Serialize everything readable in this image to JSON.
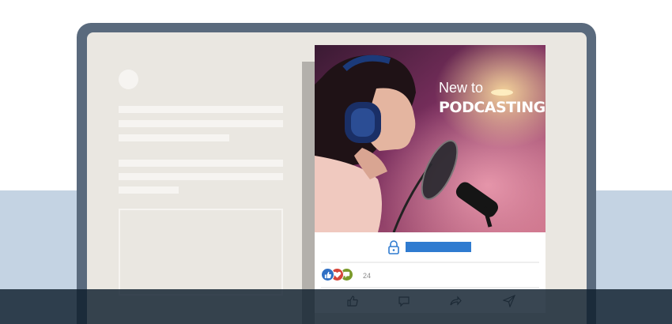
{
  "post": {
    "headline_line1": "New to",
    "headline_line2": "PODCASTING?",
    "reaction_count": "24"
  },
  "icons": {
    "lock": "lock-icon",
    "reactions": [
      "like-reaction-icon",
      "love-reaction-icon",
      "support-reaction-icon"
    ],
    "actions": [
      "like-icon",
      "comment-icon",
      "share-icon",
      "send-icon"
    ]
  },
  "colors": {
    "link_bar": "#2f7bd0",
    "laptop_frame": "#5a6a7d",
    "band": "#c4d3e3",
    "footer": "#0e1d2c"
  }
}
